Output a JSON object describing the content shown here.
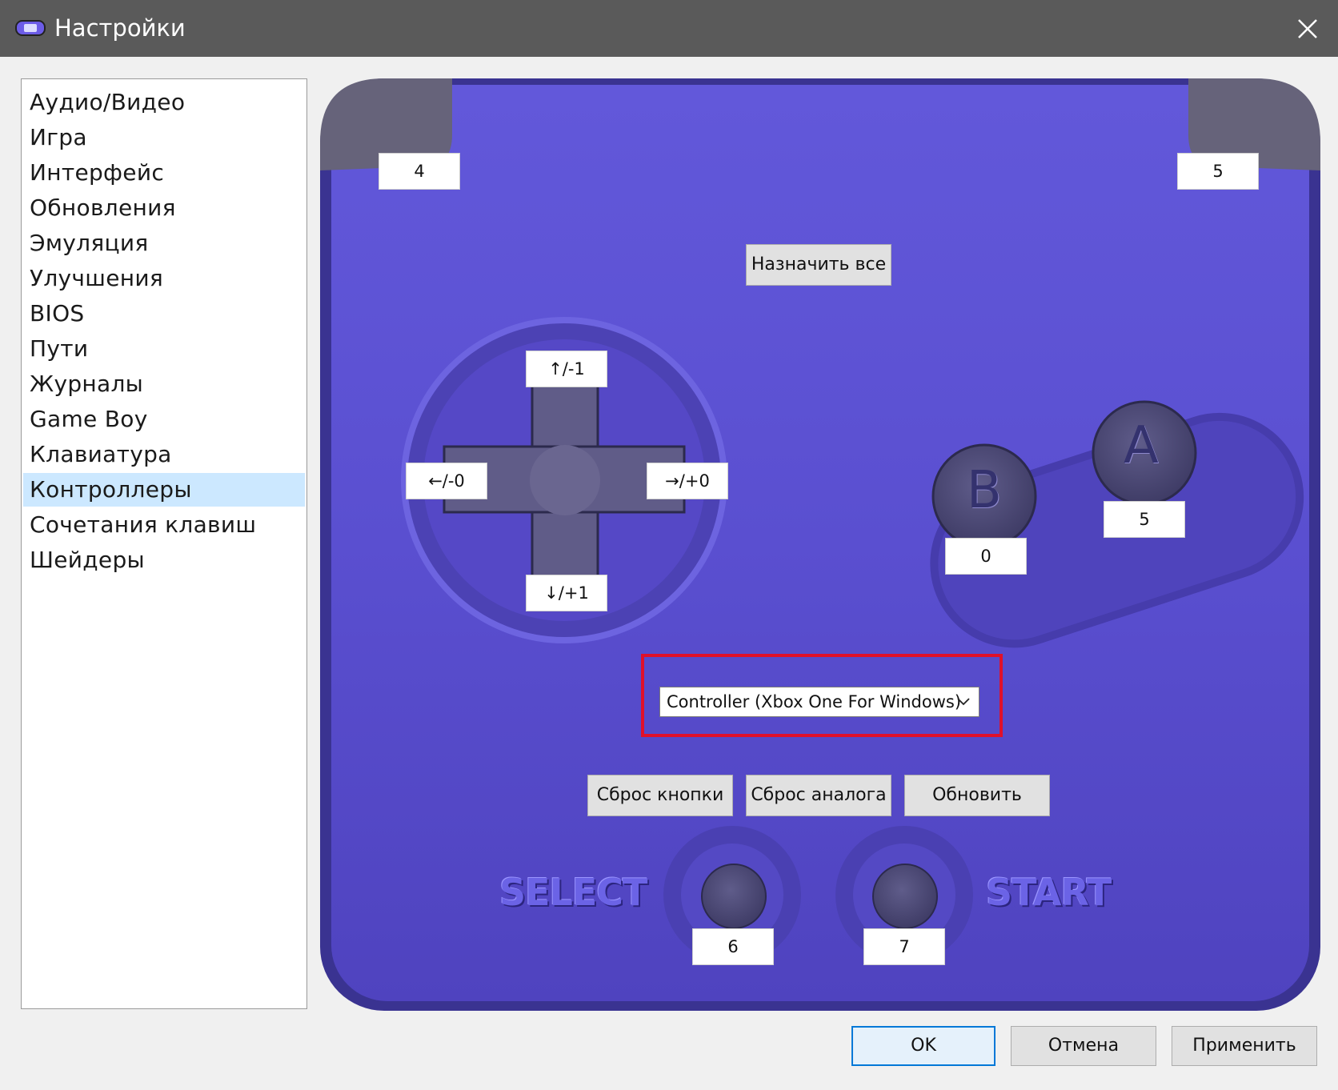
{
  "window": {
    "title": "Настройки",
    "app_icon": "gameboy-icon",
    "close_icon": "close-icon"
  },
  "sidebar": {
    "items": [
      {
        "label": "Аудио/Видео",
        "selected": false
      },
      {
        "label": "Игра",
        "selected": false
      },
      {
        "label": "Интерфейс",
        "selected": false
      },
      {
        "label": "Обновления",
        "selected": false
      },
      {
        "label": "Эмуляция",
        "selected": false
      },
      {
        "label": "Улучшения",
        "selected": false
      },
      {
        "label": "BIOS",
        "selected": false
      },
      {
        "label": "Пути",
        "selected": false
      },
      {
        "label": "Журналы",
        "selected": false
      },
      {
        "label": "Game Boy",
        "selected": false
      },
      {
        "label": "Клавиатура",
        "selected": false
      },
      {
        "label": "Контроллеры",
        "selected": true
      },
      {
        "label": "Сочетания клавиш",
        "selected": false
      },
      {
        "label": "Шейдеры",
        "selected": false
      }
    ]
  },
  "controller": {
    "l_shoulder": "4",
    "r_shoulder": "5",
    "assign_all": "Назначить все",
    "dpad_up": "↑/-1",
    "dpad_down": "↓/+1",
    "dpad_left": "←/-0",
    "dpad_right": "→/+0",
    "b_letter": "B",
    "a_letter": "A",
    "b_value": "0",
    "a_value": "5",
    "device_selected": "Controller (Xbox One For Windows)",
    "reset_buttons": "Сброс кнопки",
    "reset_analog": "Сброс аналога",
    "refresh": "Обновить",
    "select_label": "SELECT",
    "start_label": "START",
    "select_value": "6",
    "start_value": "7"
  },
  "dialog_buttons": {
    "ok": "OK",
    "cancel": "Отмена",
    "apply": "Применить"
  },
  "colors": {
    "pad_body": "#5b4fd3",
    "pad_dark": "#4a3fb8",
    "highlight": "#e0102a",
    "selected_item": "#cce8ff"
  }
}
